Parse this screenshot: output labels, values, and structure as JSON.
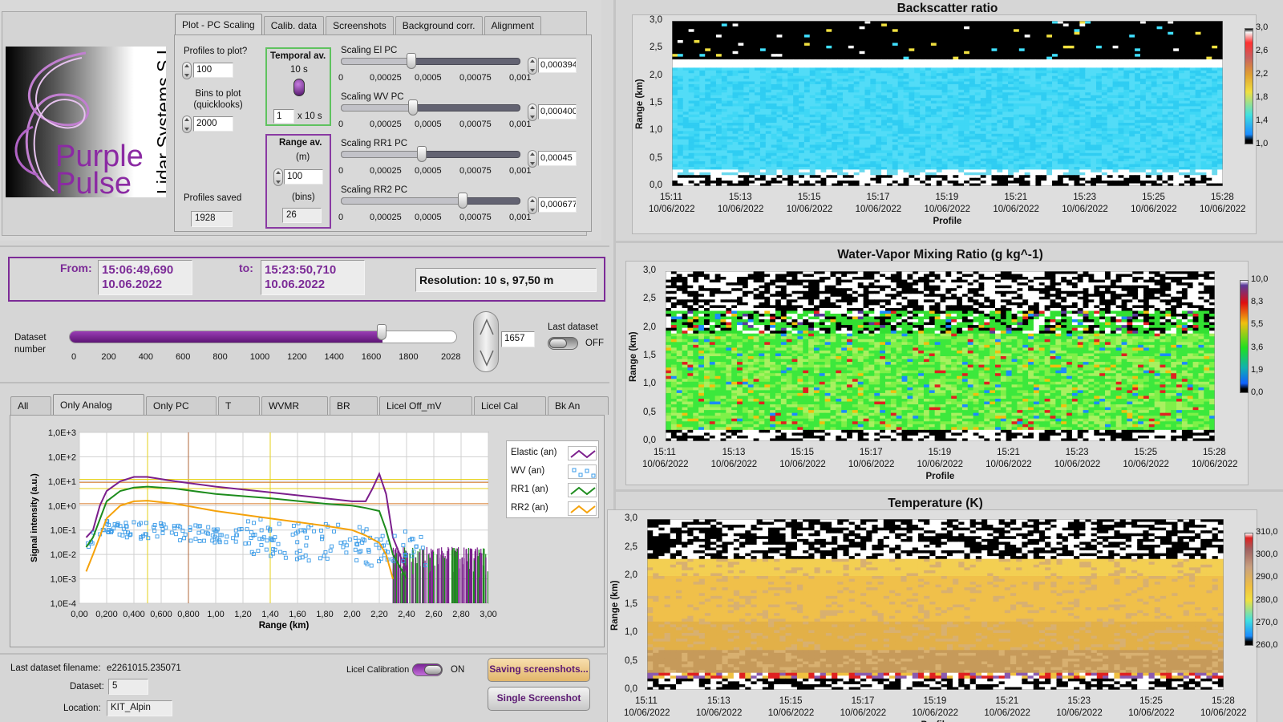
{
  "logo": {
    "brand_line1": "Purple",
    "brand_line2": "Pulse",
    "company": "Lidar Systems S.L."
  },
  "top_tabs": [
    "Plot - PC Scaling",
    "Calib. data",
    "Screenshots",
    "Background corr.",
    "Alignment"
  ],
  "plot_settings": {
    "profiles_label": "Profiles to plot?",
    "profiles_value": "100",
    "bins_label": "Bins to plot (quicklooks)",
    "bins_value": "2000",
    "profiles_saved_label": "Profiles saved",
    "profiles_saved_value": "1928",
    "temporal_label": "Temporal av.",
    "temporal_value": "10 s",
    "temporal_count": "1",
    "temporal_unit": "x 10 s",
    "range_label": "Range av.",
    "range_unit_m": "(m)",
    "range_value": "100",
    "range_bins_label": "(bins)",
    "range_bins_value": "26"
  },
  "scaling_ticks": [
    "0",
    "0,00025",
    "0,0005",
    "0,00075",
    "0,001"
  ],
  "scaling": [
    {
      "label": "Scaling El PC",
      "value": "0,000394",
      "fraction": 0.394
    },
    {
      "label": "Scaling WV PC",
      "value": "0,000400",
      "fraction": 0.4
    },
    {
      "label": "Scaling RR1 PC",
      "value": "0,00045",
      "fraction": 0.45
    },
    {
      "label": "Scaling RR2 PC",
      "value": "0,000677",
      "fraction": 0.677
    }
  ],
  "time_range": {
    "from_label": "From:",
    "from_time": "15:06:49,690",
    "from_date": "10.06.2022",
    "to_label": "to:",
    "to_time": "15:23:50,710",
    "to_date": "10.06.2022",
    "resolution": "Resolution: 10 s, 97,50 m"
  },
  "dataset_slider": {
    "label": "Dataset number",
    "ticks": [
      "0",
      "200",
      "400",
      "600",
      "800",
      "1000",
      "1200",
      "1400",
      "1600",
      "1800",
      "2028"
    ],
    "value": 1657,
    "max": 2028,
    "value_text": "1657",
    "last_label": "Last dataset",
    "last_state": "OFF"
  },
  "bottom_tabs": [
    "All",
    "Only Analog",
    "Only PC",
    "T",
    "WVMR",
    "BR",
    "Licel Off_mV",
    "Licel Cal",
    "Bk An"
  ],
  "signal_plot": {
    "y_ticks": [
      "1,0E+3",
      "1,0E+2",
      "1,0E+1",
      "1,0E+0",
      "1,0E-1",
      "1,0E-2",
      "1,0E-3",
      "1,0E-4"
    ],
    "x_ticks": [
      "0,00",
      "0,200",
      "0,400",
      "0,600",
      "0,800",
      "1,00",
      "1,20",
      "1,40",
      "1,60",
      "1,80",
      "2,00",
      "2,20",
      "2,40",
      "2,60",
      "2,80",
      "3,00"
    ],
    "ylabel": "Signal intensity (a.u.)",
    "xlabel": "Range (km)",
    "legend": [
      {
        "name": "Elastic (an)",
        "color": "#7b1e8c"
      },
      {
        "name": "WV (an)",
        "color": "#3a9be8"
      },
      {
        "name": "RR1 (an)",
        "color": "#1d8c1d"
      },
      {
        "name": "RR2 (an)",
        "color": "#f5a20a"
      }
    ]
  },
  "chart_data": [
    {
      "type": "line",
      "xlabel": "Range (km)",
      "ylabel": "Signal intensity (a.u.)",
      "ylim": [
        0.0001,
        1000
      ],
      "xlim": [
        0,
        3
      ],
      "log_y": true,
      "legend": "right",
      "series": [
        {
          "name": "Elastic (an)",
          "x": [
            0.05,
            0.1,
            0.15,
            0.2,
            0.3,
            0.4,
            0.5,
            0.7,
            1.0,
            1.4,
            1.8,
            2.0,
            2.1,
            2.15,
            2.2,
            2.25,
            2.3,
            2.4
          ],
          "y": [
            0.05,
            0.1,
            1,
            4,
            10,
            15,
            15,
            10,
            6,
            3.5,
            2,
            1.5,
            1.5,
            5,
            20,
            3,
            0.05,
            0.002
          ]
        },
        {
          "name": "WV (an)",
          "x": [
            0.05,
            0.1,
            0.2,
            0.3,
            0.4,
            0.5,
            0.7,
            1.0,
            1.4,
            1.8,
            2.0,
            2.2,
            2.3
          ],
          "y": [
            0.002,
            0.01,
            0.05,
            0.08,
            0.1,
            0.1,
            0.07,
            0.04,
            0.03,
            0.02,
            0.015,
            0.01,
            0.005
          ]
        },
        {
          "name": "RR1 (an)",
          "x": [
            0.05,
            0.1,
            0.2,
            0.3,
            0.4,
            0.5,
            0.7,
            1.0,
            1.4,
            1.8,
            2.0,
            2.1,
            2.2,
            2.25,
            2.3,
            2.4
          ],
          "y": [
            0.02,
            0.05,
            1.5,
            4,
            5.5,
            6,
            5,
            3,
            2,
            1.2,
            1,
            0.8,
            0.6,
            0.1,
            0.01,
            0.001
          ]
        },
        {
          "name": "RR2 (an)",
          "x": [
            0.05,
            0.1,
            0.2,
            0.3,
            0.4,
            0.5,
            0.7,
            1.0,
            1.4,
            1.8,
            2.0,
            2.1,
            2.2,
            2.25,
            2.3
          ],
          "y": [
            0.002,
            0.01,
            0.3,
            1,
            1.5,
            1.6,
            1.2,
            0.6,
            0.3,
            0.15,
            0.1,
            0.06,
            0.03,
            0.01,
            0.001
          ]
        }
      ]
    },
    {
      "type": "heatmap",
      "title": "Backscatter ratio",
      "xlabel": "Profile",
      "ylabel": "Range (km)",
      "ylim": [
        0,
        3
      ],
      "x_ticks": [
        "15:11",
        "15:13",
        "15:15",
        "15:17",
        "15:19",
        "15:21",
        "15:23",
        "15:25",
        "15:28"
      ],
      "x_dates": "10/06/2022",
      "colorbar": [
        "3,0",
        "2,6",
        "2,2",
        "1,8",
        "1,4",
        "1,0"
      ]
    },
    {
      "type": "heatmap",
      "title": "Water-Vapor Mixing Ratio  (g kg^-1)",
      "xlabel": "Profile",
      "ylabel": "Range (km)",
      "ylim": [
        0,
        3
      ],
      "x_ticks": [
        "15:11",
        "15:13",
        "15:15",
        "15:17",
        "15:19",
        "15:21",
        "15:23",
        "15:25",
        "15:28"
      ],
      "x_dates": "10/06/2022",
      "colorbar": [
        "10,0",
        "8,3",
        "5,5",
        "3,6",
        "1,9",
        "0,0"
      ]
    },
    {
      "type": "heatmap",
      "title": "Temperature (K)",
      "xlabel": "Profile",
      "ylabel": "Range (km)",
      "ylim": [
        0,
        3
      ],
      "x_ticks": [
        "15:11",
        "15:13",
        "15:15",
        "15:17",
        "15:19",
        "15:21",
        "15:23",
        "15:25",
        "15:28"
      ],
      "x_dates": "10/06/2022",
      "colorbar": [
        "310,0",
        "300,0",
        "290,0",
        "280,0",
        "270,0",
        "260,0"
      ]
    }
  ],
  "heat_y_ticks": [
    "3,0",
    "2,5",
    "2,0",
    "1,5",
    "1,0",
    "0,5",
    "0,0"
  ],
  "status": {
    "filename_label": "Last dataset filename:",
    "filename_value": "e2261015.235071",
    "dataset_label": "Dataset:",
    "dataset_value": "5",
    "location_label": "Location:",
    "location_value": "KIT_Alpin",
    "licel_label": "Licel Calibration",
    "licel_state": "ON",
    "save_btn": "Saving screenshots...",
    "single_btn": "Single Screenshot"
  }
}
